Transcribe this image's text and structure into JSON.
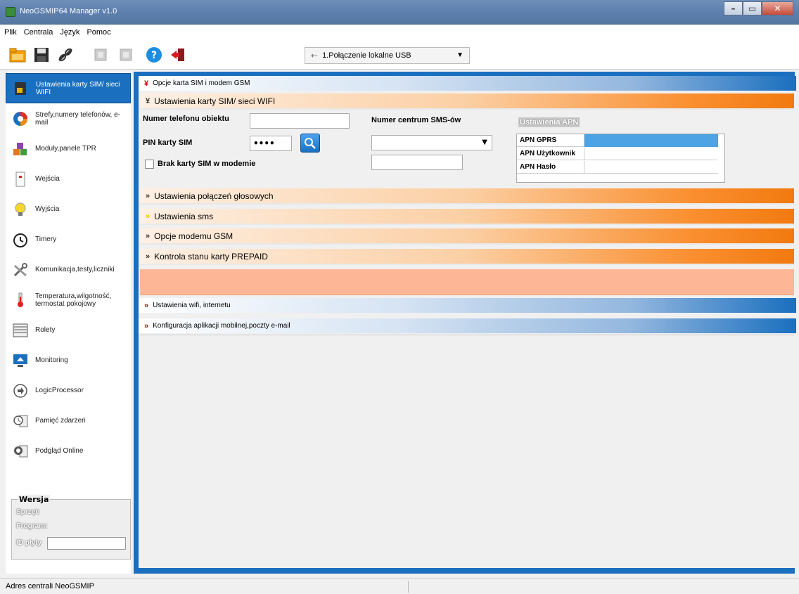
{
  "window": {
    "title": "NeoGSMIP64 Manager v1.0"
  },
  "menu": [
    "Plik",
    "Centrala",
    "Język",
    "Pomoc"
  ],
  "toolbar": {
    "connection": "1.Połączenie lokalne USB"
  },
  "sidebar": {
    "items": [
      {
        "label": "Ustawienia karty SIM/ sieci WIFI",
        "icon": "sim-card-icon"
      },
      {
        "label": "Strefy,numery telefonów, e-mail",
        "icon": "zones-icon"
      },
      {
        "label": "Moduły,panele TPR",
        "icon": "modules-icon"
      },
      {
        "label": "Wejścia",
        "icon": "inputs-icon"
      },
      {
        "label": "Wyjścia",
        "icon": "bulb-icon"
      },
      {
        "label": "Timery",
        "icon": "clock-icon"
      },
      {
        "label": "Komunikacja,testy,liczniki",
        "icon": "tools-icon"
      },
      {
        "label": "Temperatura,wilgotność, termostat pokojowy",
        "icon": "thermometer-icon"
      },
      {
        "label": "Rolety",
        "icon": "blinds-icon"
      },
      {
        "label": "Monitoring",
        "icon": "monitor-icon"
      },
      {
        "label": "LogicProcessor",
        "icon": "logic-icon"
      },
      {
        "label": "Pamięć zdarzeń",
        "icon": "events-icon"
      },
      {
        "label": "Podgląd Online",
        "icon": "online-icon"
      }
    ],
    "version": {
      "title": "Wersja",
      "hw": "Sprzęt:",
      "sw": "Program:",
      "board_id": "ID płyty"
    }
  },
  "main": {
    "section1": "Opcje karta SIM i modem GSM",
    "sub1": "Ustawienia karty SIM/ sieci WIFI",
    "phone_label": "Numer telefonu obiektu",
    "sms_center_label": "Numer centrum SMS-ów",
    "pin_label": "PIN karty SIM",
    "pin_value": "••••",
    "no_sim_label": "Brak karty SIM w modemie",
    "apn_title": "Ustawienia APN",
    "apn_rows": [
      "APN GPRS",
      "APN Użytkownik",
      "APN Hasło"
    ],
    "sub2": "Ustawienia połączeń głosowych",
    "sub3": "Ustawienia sms",
    "sub4": "Opcje modemu GSM",
    "sub5": "Kontrola stanu karty PREPAID",
    "section2": "Ustawienia wifi, internetu",
    "section3": "Konfiguracja aplikacji mobilnej,poczty e-mail"
  },
  "status": {
    "text": "Adres centrali NeoGSMIP"
  },
  "colors": {
    "accent": "#1a6fbf",
    "orange": "#f17a10",
    "salmon": "#fdb797"
  }
}
